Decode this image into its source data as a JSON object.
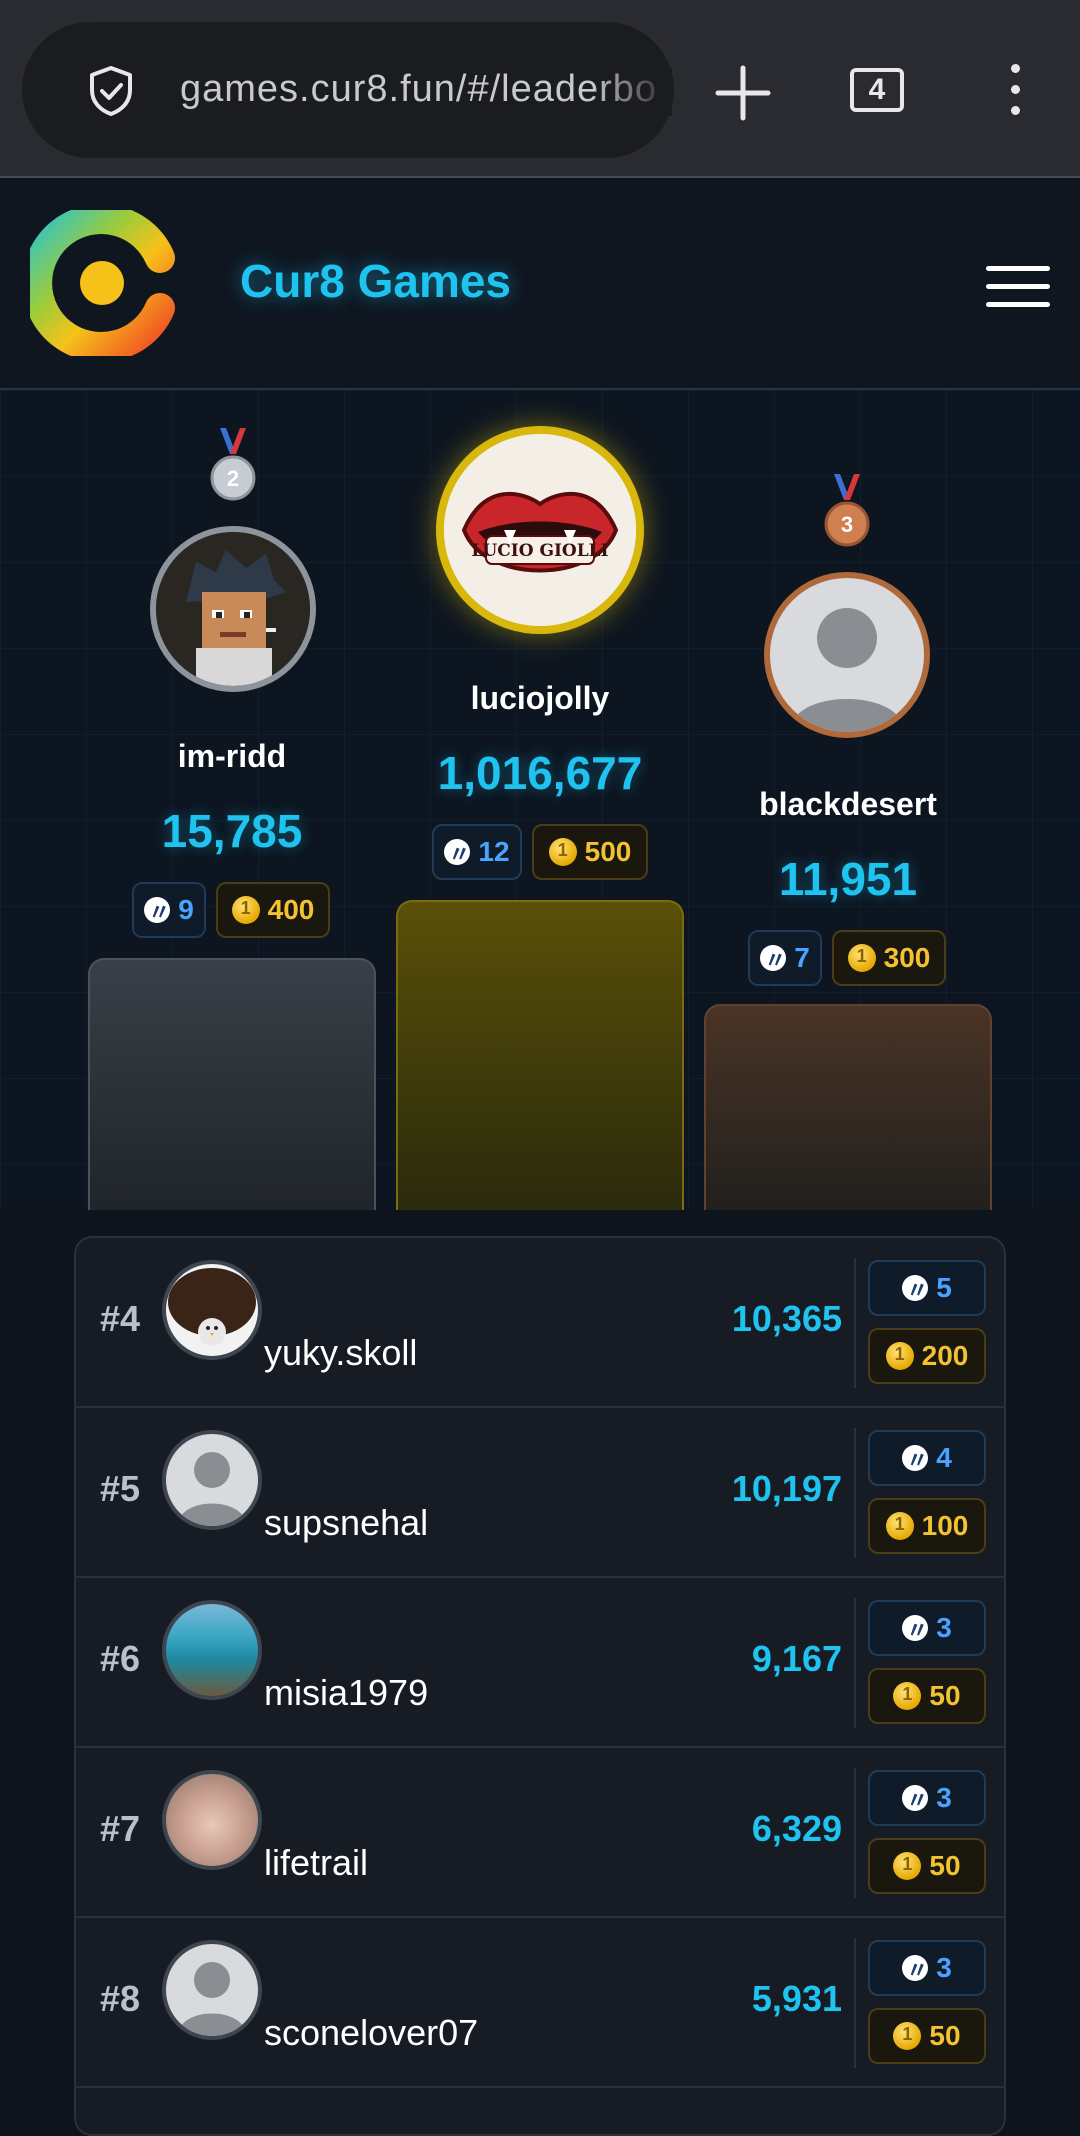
{
  "browser": {
    "url": "games.cur8.fun/#/leaderbo",
    "tab_count": "4"
  },
  "header": {
    "brand": "Cur8 Games"
  },
  "podium": [
    {
      "place": "2",
      "name": "im-ridd",
      "score": "15,785",
      "hive": "9",
      "coins": "400"
    },
    {
      "place": "1",
      "name": "luciojolly",
      "score": "1,016,677",
      "hive": "12",
      "coins": "500",
      "avatar_text": "LUCIO GIOLLI"
    },
    {
      "place": "3",
      "name": "blackdesert",
      "score": "11,951",
      "hive": "7",
      "coins": "300"
    }
  ],
  "rows": [
    {
      "rank": "#4",
      "name": "yuky.skoll",
      "score": "10,365",
      "hive": "5",
      "coins": "200"
    },
    {
      "rank": "#5",
      "name": "supsnehal",
      "score": "10,197",
      "hive": "4",
      "coins": "100"
    },
    {
      "rank": "#6",
      "name": "misia1979",
      "score": "9,167",
      "hive": "3",
      "coins": "50"
    },
    {
      "rank": "#7",
      "name": "lifetrail",
      "score": "6,329",
      "hive": "3",
      "coins": "50"
    },
    {
      "rank": "#8",
      "name": "sconelover07",
      "score": "5,931",
      "hive": "3",
      "coins": "50"
    }
  ],
  "colors": {
    "accent": "#1ec3f0",
    "gold": "#f2c230",
    "silver": "#9aa0a8",
    "bronze": "#b0693a"
  },
  "icons": [
    "shield-icon",
    "plus-icon",
    "tabs-icon",
    "more-vert-icon",
    "hamburger-icon",
    "hive-icon",
    "coin-icon",
    "medal-icon"
  ]
}
